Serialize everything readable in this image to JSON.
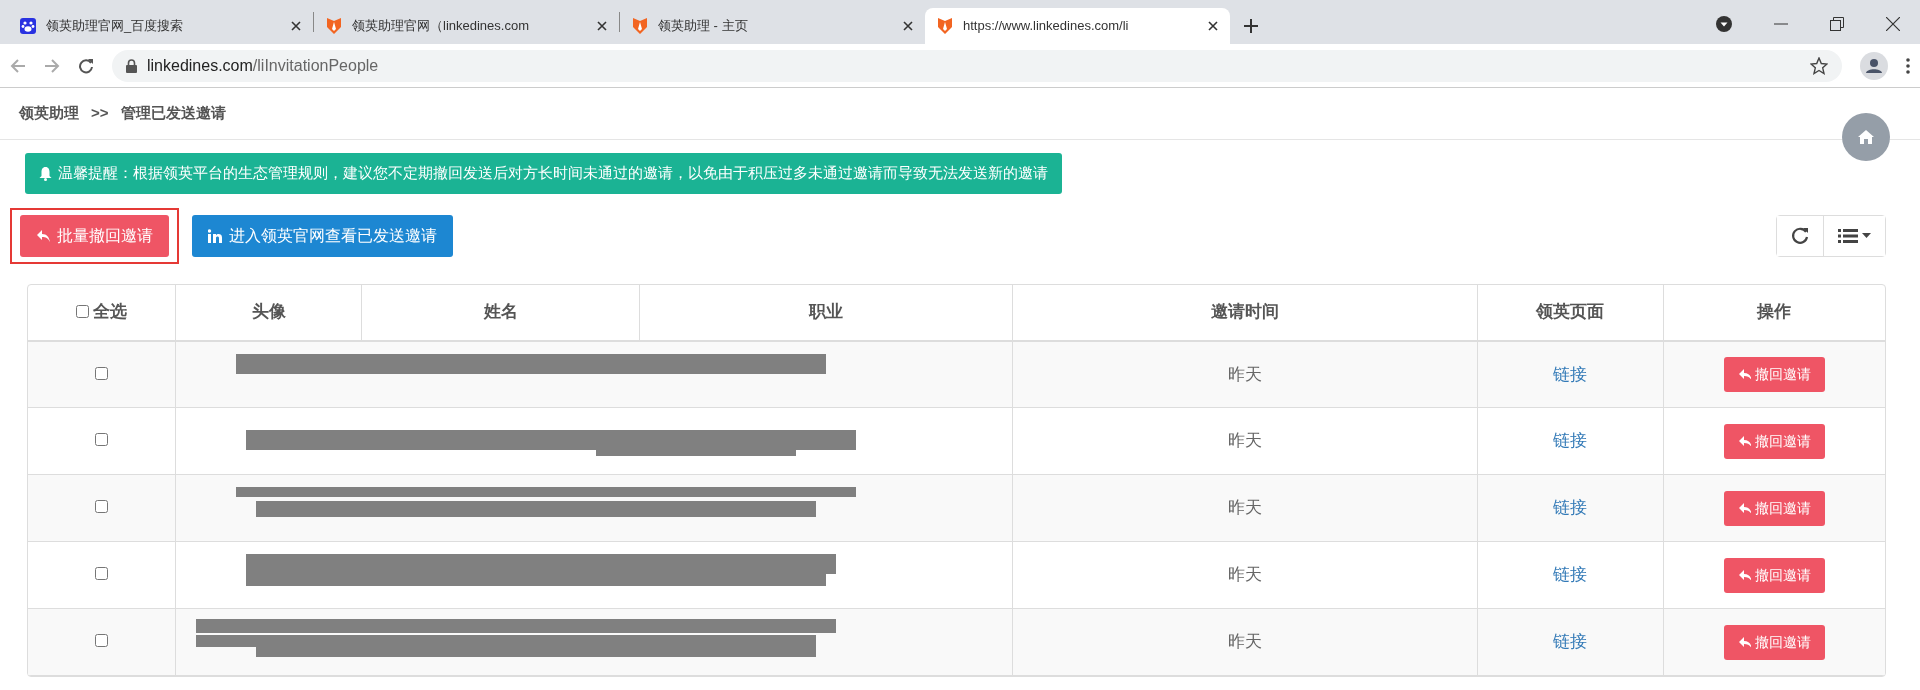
{
  "browser": {
    "tabs": [
      {
        "title": "领英助理官网_百度搜索",
        "selected": false
      },
      {
        "title": "领英助理官网（linkedines.com",
        "selected": false
      },
      {
        "title": "领英助理 - 主页",
        "selected": false
      },
      {
        "title": "https://www.linkedines.com/li",
        "selected": true
      }
    ],
    "address": {
      "host": "linkedines.com",
      "path": "/liInvitationPeople"
    }
  },
  "breadcrumb": [
    {
      "label": "领英助理"
    },
    {
      "label": ">>"
    },
    {
      "label": "管理已发送邀请"
    }
  ],
  "alert": "温馨提醒：根据领英平台的生态管理规则，建议您不定期撤回发送后对方长时间未通过的邀请，以免由于积压过多未通过邀请而导致无法发送新的邀请",
  "actions": [
    {
      "label": "批量撤回邀请",
      "kind": "danger",
      "outlined": true
    },
    {
      "label": "进入领英官网查看已发送邀请",
      "kind": "primary",
      "outlined": false
    }
  ],
  "table": {
    "select_all": {
      "label": "全选",
      "checked": false
    },
    "columns": [
      "头像",
      "姓名",
      "职业",
      "邀请时间",
      "领英页面",
      "操作"
    ],
    "rows": [
      {
        "checked": false,
        "time": "昨天",
        "link": "链接",
        "action": "撤回邀请"
      },
      {
        "checked": false,
        "time": "昨天",
        "link": "链接",
        "action": "撤回邀请"
      },
      {
        "checked": false,
        "time": "昨天",
        "link": "链接",
        "action": "撤回邀请"
      },
      {
        "checked": false,
        "time": "昨天",
        "link": "链接",
        "action": "撤回邀请"
      },
      {
        "checked": false,
        "time": "昨天",
        "link": "链接",
        "action": "撤回邀请"
      }
    ]
  }
}
